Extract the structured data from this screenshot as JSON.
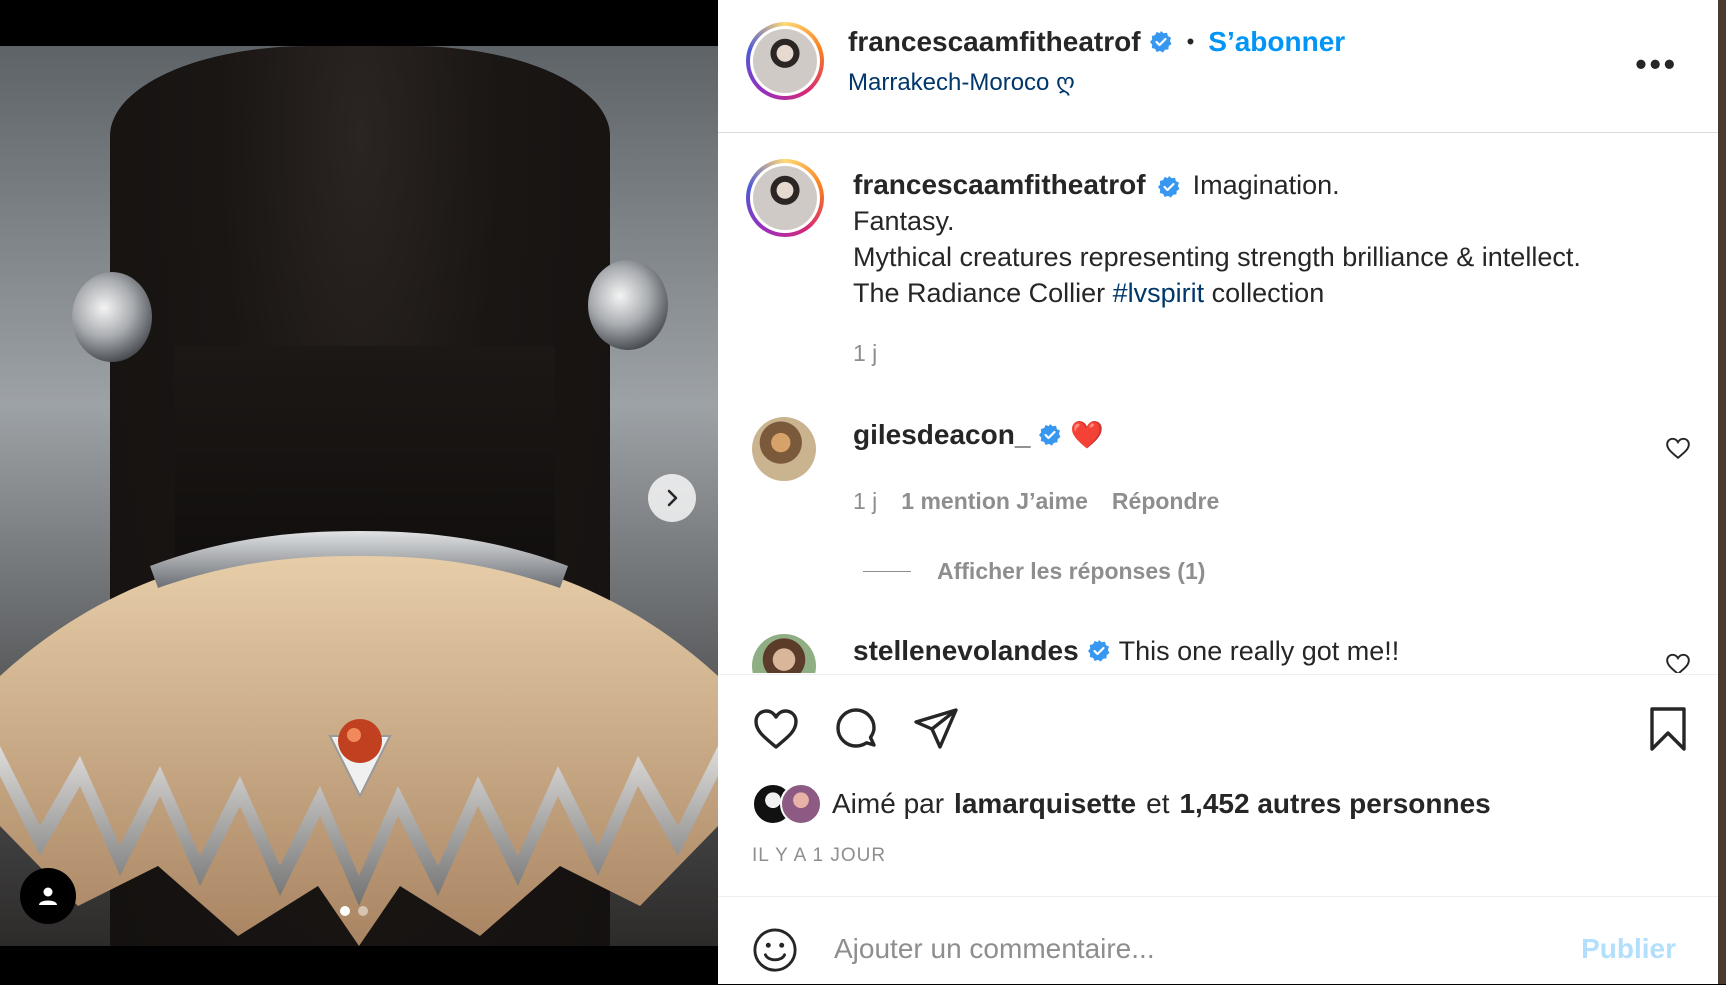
{
  "post": {
    "author": "francescaamfitheatrof",
    "follow_label": "S’abonner",
    "separator": "•",
    "location": "Marrakech-Moroco ღ",
    "more_label": "•••"
  },
  "caption": {
    "author": "francescaamfitheatrof",
    "line1": "Imagination.",
    "line2": "Fantasy.",
    "line3": "Mythical creatures representing strength brilliance & intellect.",
    "line4_pre": "The Radiance Collier ",
    "hashtag": "#lvspirit",
    "line4_post": " collection",
    "time": "1 j"
  },
  "comments": [
    {
      "author": "gilesdeacon_",
      "text": "❤️",
      "time": "1 j",
      "likes": "1 mention J’aime",
      "reply": "Répondre",
      "view_replies": "Afficher les réponses (1)"
    },
    {
      "author": "stellenevolandes",
      "text": "This one really got me!!"
    }
  ],
  "likes": {
    "prefix": "Aimé par",
    "user": "lamarquisette",
    "and": "et",
    "count": "1,452 autres personnes"
  },
  "timestamp": "IL Y A 1 JOUR",
  "add_comment": {
    "placeholder": "Ajouter un commentaire...",
    "publish": "Publier"
  },
  "carousel": {
    "total_slides": 2,
    "active_slide": 1
  },
  "colors": {
    "accent": "#0095f6",
    "link": "#00376b",
    "muted": "#8e8e8e",
    "heart_red": "#ed4956",
    "verified": "#3897f0"
  }
}
